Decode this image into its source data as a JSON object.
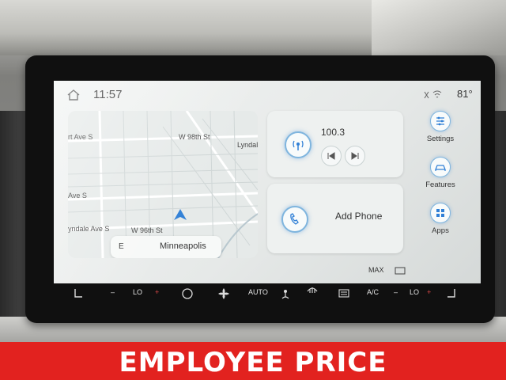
{
  "status_bar": {
    "time": "11:57",
    "temperature": "81°"
  },
  "map": {
    "labels": [
      "W 98th St",
      "Lyndal",
      "rt Ave S",
      "Ave S",
      "yndale Ave S",
      "W 96th St"
    ],
    "destination_direction": "E",
    "destination": "Minneapolis"
  },
  "radio": {
    "station": "100.3"
  },
  "phone": {
    "label": "Add Phone"
  },
  "side_menu": [
    {
      "label": "Settings",
      "icon": "sliders-icon"
    },
    {
      "label": "Features",
      "icon": "car-icon"
    },
    {
      "label": "Apps",
      "icon": "grid-icon"
    }
  ],
  "climate": {
    "left_temp": "LO",
    "right_temp": "LO",
    "auto_label": "AUTO",
    "ac_label": "A/C",
    "max_label": "MAX"
  },
  "banner": {
    "text": "EMPLOYEE PRICE"
  },
  "colors": {
    "accent": "#7fb5de",
    "banner": "#e2221f"
  }
}
